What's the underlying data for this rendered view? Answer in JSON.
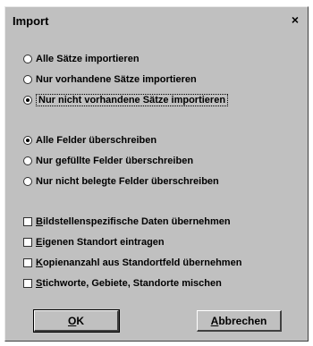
{
  "dialog": {
    "title": "Import",
    "close_glyph": "×"
  },
  "group1": [
    {
      "label": "Alle Sätze importieren",
      "checked": false
    },
    {
      "label": "Nur vorhandene Sätze importieren",
      "checked": false
    },
    {
      "label": "Nur nicht vorhandene Sätze importieren",
      "checked": true
    }
  ],
  "group2": [
    {
      "label": "Alle Felder überschreiben",
      "checked": true
    },
    {
      "label": "Nur gefüllte Felder überschreiben",
      "checked": false
    },
    {
      "label": "Nur nicht belegte Felder überschreiben",
      "checked": false
    }
  ],
  "checkboxes": [
    {
      "ul": "B",
      "rest": "ildstellenspezifische Daten übernehmen",
      "checked": false
    },
    {
      "ul": "E",
      "rest": "igenen Standort eintragen",
      "checked": false
    },
    {
      "ul": "K",
      "rest": "opienanzahl aus Standortfeld übernehmen",
      "checked": false
    },
    {
      "ul": "S",
      "rest": "tichworte, Gebiete, Standorte mischen",
      "checked": false
    }
  ],
  "buttons": {
    "ok_ul": "O",
    "ok_rest": "K",
    "cancel_ul": "A",
    "cancel_rest": "bbrechen"
  }
}
